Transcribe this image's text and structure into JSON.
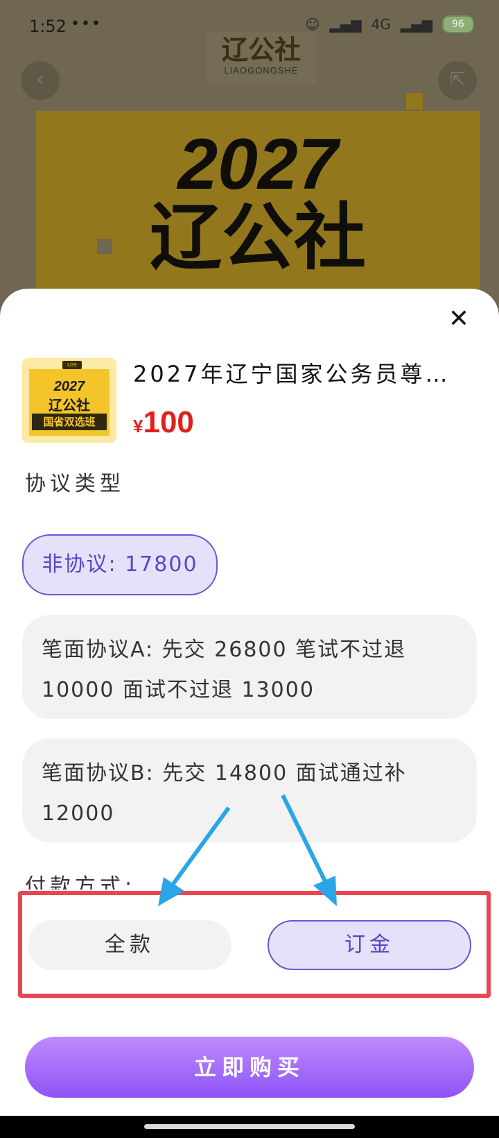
{
  "status": {
    "time": "1:52",
    "dots": "•••",
    "battery": "96",
    "network": "4G"
  },
  "header": {
    "logo_main": "辽公社",
    "logo_sub": "LIAOGONGSHE",
    "back_icon": "chevron-left-icon",
    "share_icon": "share-icon"
  },
  "poster": {
    "year": "2027",
    "name": "辽公社"
  },
  "product": {
    "thumbnail": {
      "year": "2027",
      "name": "辽公社",
      "tag": "国省双选班"
    },
    "title": "2027年辽宁国家公务员尊…",
    "price_symbol": "¥",
    "price": "100"
  },
  "agreement": {
    "label": "协议类型",
    "options": [
      {
        "label": "非协议: 17800",
        "selected": true
      },
      {
        "label": "笔面协议A: 先交 26800 笔试不过退 10000 面试不过退 13000",
        "selected": false
      },
      {
        "label": "笔面协议B: 先交 14800 面试通过补 12000",
        "selected": false
      }
    ]
  },
  "payment": {
    "label": "付款方式:",
    "options": [
      {
        "label": "全款",
        "selected": false
      },
      {
        "label": "订金",
        "selected": true
      }
    ]
  },
  "buy_button": "立即购买",
  "colors": {
    "accent": "#6c54d6",
    "price": "#e0201b",
    "highlight_box": "#ea4651",
    "arrow": "#2aa6e8"
  }
}
